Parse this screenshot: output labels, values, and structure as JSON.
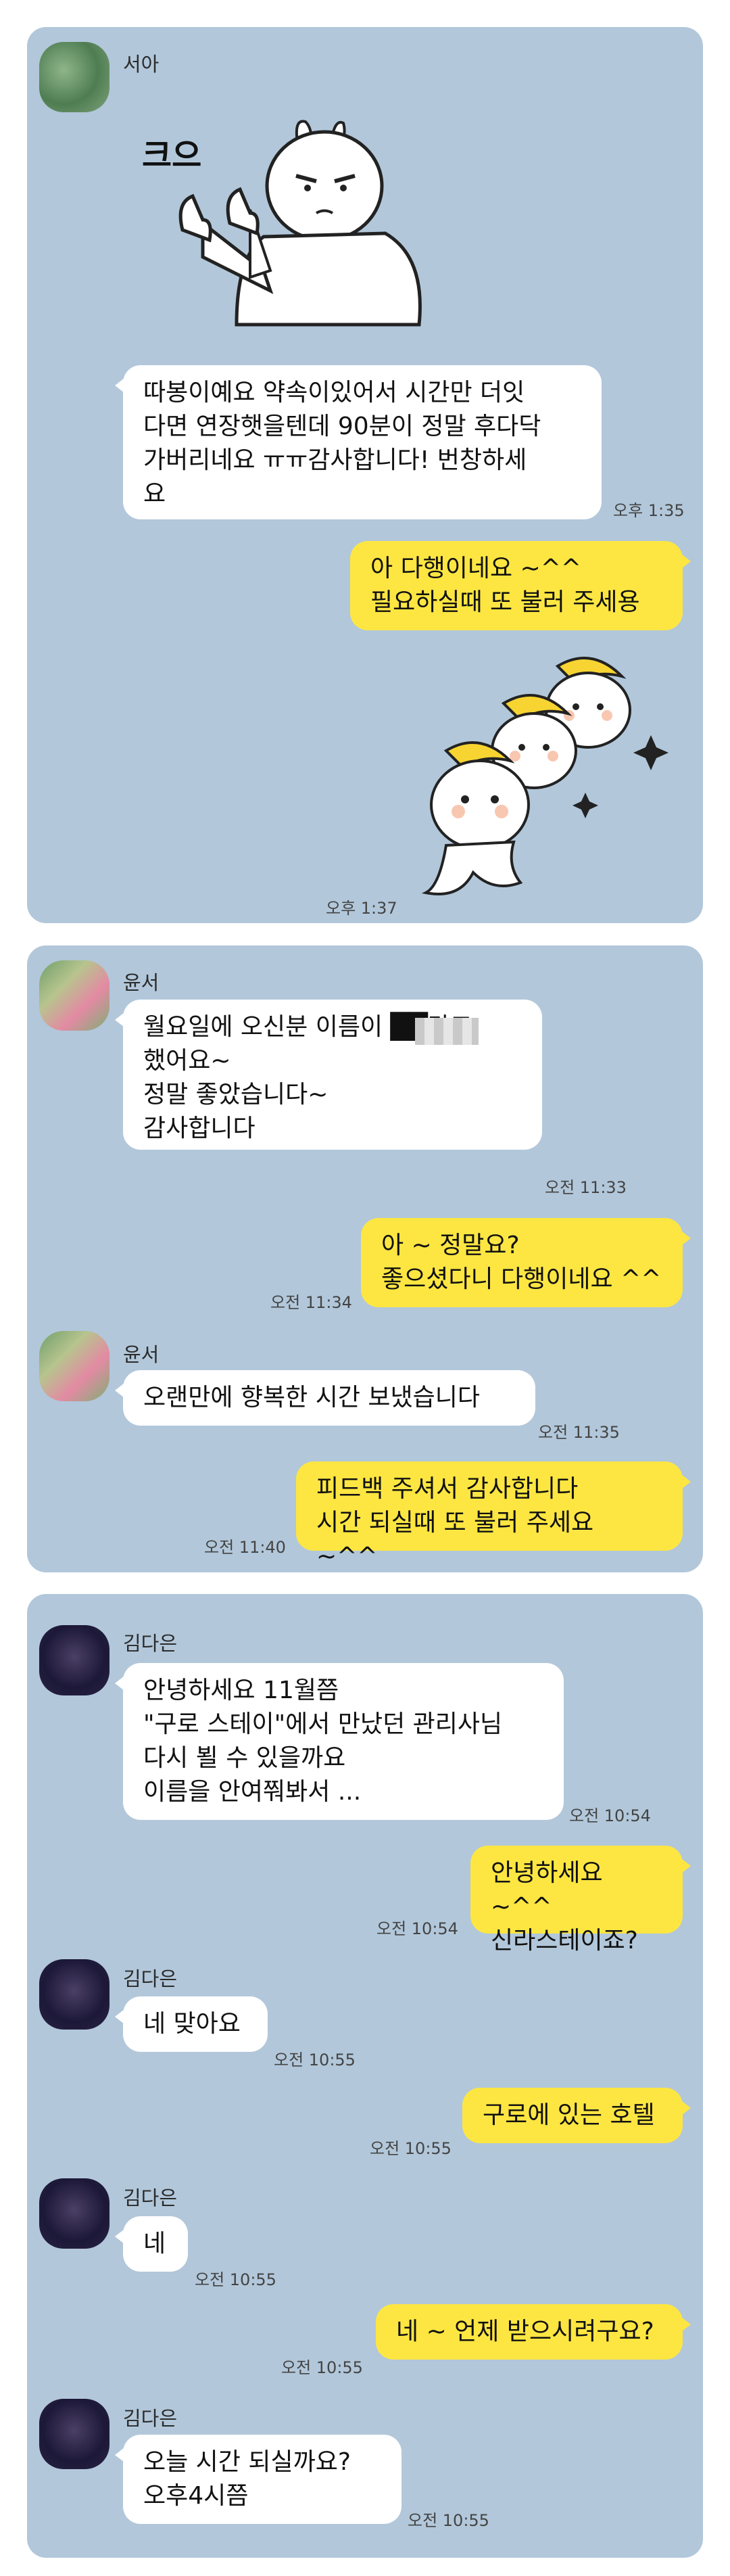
{
  "panel1": {
    "sender": "서아",
    "sticker_text": "크으",
    "msg1": "따봉이예요 약속이있어서 시간만 더잇\n다면 연장햇을텐데 90분이 정말 후다닥\n가버리네요 ㅠㅠ감사합니다! 번창하세\n요",
    "time1": "오후 1:35",
    "reply": "아 다행이네요 ~^^\n필요하실때 또 불러 주세용",
    "time2": "오후 1:37"
  },
  "panel2": {
    "sender1": "윤서",
    "msg1": "월요일에 오신분 이름이 ██라고\n했어요~\n정말 좋았습니다~\n감사합니다",
    "time1": "오전 11:33",
    "reply1": "아 ~ 정말요?\n좋으셨다니 다행이네요 ^^",
    "time2": "오전 11:34",
    "sender2": "윤서",
    "msg2": "오랜만에 향복한 시간 보냈습니다",
    "time3": "오전 11:35",
    "reply2": "피드백 주셔서 감사합니다\n시간 되실때 또 불러 주세요 ~^^",
    "time4": "오전 11:40"
  },
  "panel3": {
    "sender": "김다은",
    "msg1": "안녕하세요 11월쯤\n\"구로 스테이\"에서 만났던 관리사님\n다시 뵐 수 있을까요\n이름을 안여쭤봐서 ...",
    "time1": "오전 10:54",
    "reply1": "안녕하세요 ~^^\n신라스테이죠?",
    "time2": "오전 10:54",
    "msg2": "네 맞아요",
    "time3": "오전 10:55",
    "reply2": "구로에 있는 호텔",
    "time4": "오전 10:55",
    "msg3": "네",
    "time5": "오전 10:55",
    "reply3": "네 ~ 언제 받으시려구요?",
    "time6": "오전 10:55",
    "msg4": "오늘  시간 되실까요?\n오후4시쯤",
    "time7": "오전 10:55"
  }
}
